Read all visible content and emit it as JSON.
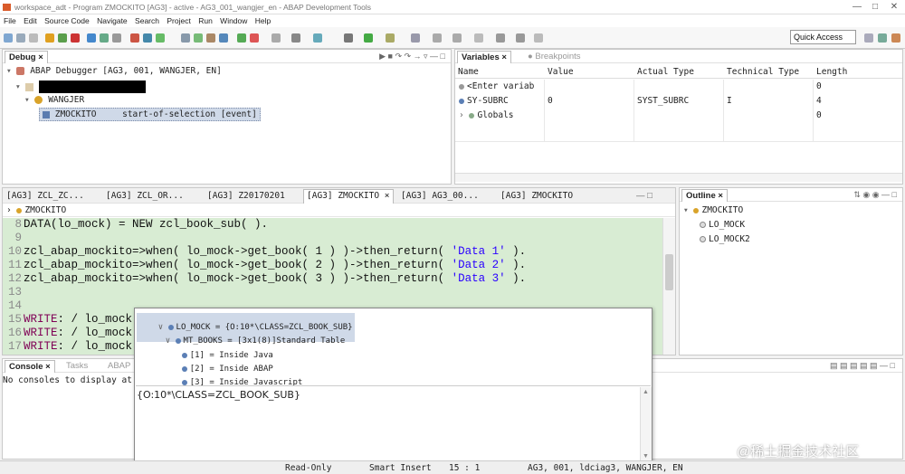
{
  "window": {
    "title": "workspace_adt - Program ZMOCKITO [AG3] - active - AG3_001_wangjer_en - ABAP Development Tools"
  },
  "menu": [
    "File",
    "Edit",
    "Source Code",
    "Navigate",
    "Search",
    "Project",
    "Run",
    "Window",
    "Help"
  ],
  "toolbar": {
    "quick_access": "Quick Access"
  },
  "debug_view": {
    "tab": "Debug",
    "tree": {
      "root": "ABAP Debugger [AG3, 001, WANGJER, EN]",
      "user": "WANGJER",
      "frame_program": "ZMOCKITO",
      "frame_event": "start-of-selection [event]"
    }
  },
  "variables_view": {
    "tabs": [
      "Variables",
      "Breakpoints"
    ],
    "columns": [
      "Name",
      "Value",
      "Actual Type",
      "Technical Type",
      "Length"
    ],
    "rows": [
      [
        "<Enter variab",
        "",
        "",
        "",
        "0"
      ],
      [
        "SY-SUBRC",
        "0",
        "SYST_SUBRC",
        "I",
        "4"
      ],
      [
        "Globals",
        "",
        "",
        "",
        "0"
      ]
    ]
  },
  "editor": {
    "tabs": [
      "[AG3] ZCL_ZC...",
      "[AG3] ZCL_OR...",
      "[AG3] Z20170201",
      "[AG3] ZMOCKITO",
      "[AG3] AG3_00...",
      "[AG3] ZMOCKITO"
    ],
    "breadcrumb": "ZMOCKITO",
    "lines": [
      {
        "n": "8",
        "code": [
          {
            "t": "plain",
            "v": "DATA(lo_mock) = NEW zcl_book_sub( )."
          }
        ]
      },
      {
        "n": "9",
        "code": []
      },
      {
        "n": "10",
        "code": [
          {
            "t": "plain",
            "v": "zcl_abap_mockito=>when( lo_mock->get_book( 1 ) )->then_return( "
          },
          {
            "t": "str",
            "v": "'Data 1'"
          },
          {
            "t": "plain",
            "v": " )."
          }
        ]
      },
      {
        "n": "11",
        "code": [
          {
            "t": "plain",
            "v": "zcl_abap_mockito=>when( lo_mock->get_book( 2 ) )->then_return( "
          },
          {
            "t": "str",
            "v": "'Data 2'"
          },
          {
            "t": "plain",
            "v": " )."
          }
        ]
      },
      {
        "n": "12",
        "code": [
          {
            "t": "plain",
            "v": "zcl_abap_mockito=>when( lo_mock->get_book( 3 ) )->then_return( "
          },
          {
            "t": "str",
            "v": "'Data 3'"
          },
          {
            "t": "plain",
            "v": " )."
          }
        ]
      },
      {
        "n": "13",
        "code": []
      },
      {
        "n": "14",
        "code": []
      },
      {
        "n": "15",
        "code": [
          {
            "t": "kw",
            "v": "WRITE"
          },
          {
            "t": "plain",
            "v": ": / lo_mock"
          }
        ]
      },
      {
        "n": "16",
        "code": [
          {
            "t": "kw",
            "v": "WRITE"
          },
          {
            "t": "plain",
            "v": ": / lo_mock"
          }
        ]
      },
      {
        "n": "17",
        "code": [
          {
            "t": "kw",
            "v": "WRITE"
          },
          {
            "t": "plain",
            "v": ": / lo_mock"
          }
        ]
      }
    ]
  },
  "outline_view": {
    "tab": "Outline",
    "root": "ZMOCKITO",
    "items": [
      "LO_MOCK",
      "LO_MOCK2"
    ]
  },
  "console_view": {
    "tabs": [
      "Console",
      "Tasks",
      "ABAP"
    ],
    "message": "No consoles to display at"
  },
  "hover_popup": {
    "root": "LO_MOCK = {O:10*\\CLASS=ZCL_BOOK_SUB}",
    "child": "MT_BOOKS = [3x1(8)]Standard Table",
    "items": [
      "[1] = Inside Java",
      "[2] = Inside ABAP",
      "[3] = Inside Javascript"
    ],
    "detail": "{O:10*\\CLASS=ZCL_BOOK_SUB}"
  },
  "statusbar": {
    "mode": "Read-Only",
    "insert": "Smart Insert",
    "position": "15 : 1",
    "system": "AG3, 001, ldciag3, WANGJER, EN"
  },
  "watermark": "@稀土掘金技术社区",
  "colors": {
    "code_highlight": "#d8ecd3",
    "keyword": "#7f0055",
    "string": "#2a00ff",
    "selection": "#cfd9e8"
  }
}
